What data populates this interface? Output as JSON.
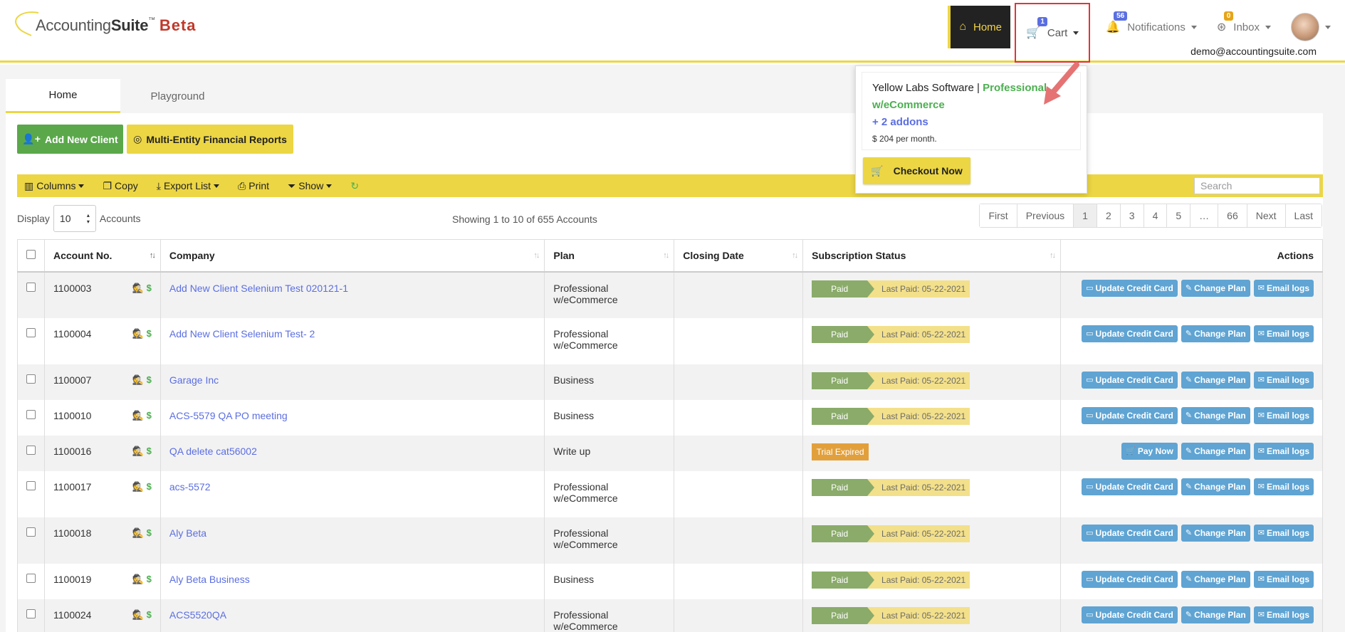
{
  "app": {
    "logo_main": "Accounting",
    "logo_bold": "Suite",
    "logo_tm": "™",
    "logo_beta": "Beta"
  },
  "nav": {
    "home": "Home",
    "cart": "Cart",
    "cart_count": "1",
    "notifications": "Notifications",
    "notifications_count": "56",
    "inbox": "Inbox",
    "inbox_count": "0",
    "user_email": "demo@accountingsuite.com"
  },
  "cart_popover": {
    "company": "Yellow Labs Software",
    "separator": "|",
    "plan": "Professional w/eCommerce",
    "addons": "+ 2 addons",
    "price": "$ 204 per month.",
    "checkout": "Checkout Now"
  },
  "tabs": [
    {
      "label": "Home",
      "active": true
    },
    {
      "label": "Playground",
      "active": false
    }
  ],
  "buttons": {
    "add_client": "Add New Client",
    "multi_entity": "Multi-Entity Financial Reports"
  },
  "toolbar": {
    "columns": "Columns",
    "copy": "Copy",
    "export": "Export List",
    "print": "Print",
    "show": "Show",
    "search_placeholder": "Search"
  },
  "listing": {
    "display_label": "Display",
    "display_value": "10",
    "accounts_label": "Accounts",
    "showing": "Showing 1 to 10 of 655 Accounts"
  },
  "pagination": [
    "First",
    "Previous",
    "1",
    "2",
    "3",
    "4",
    "5",
    "…",
    "66",
    "Next",
    "Last"
  ],
  "table": {
    "headers": {
      "account": "Account No.",
      "company": "Company",
      "plan": "Plan",
      "closing": "Closing Date",
      "status": "Subscription Status",
      "actions": "Actions"
    },
    "rows": [
      {
        "account": "1100003",
        "company": "Add New Client Selenium Test 020121-1",
        "plan1": "Professional",
        "plan2": "w/eCommerce",
        "status": "Paid",
        "last_paid": "Last Paid: 05-22-2021",
        "first_action": "Update Credit Card"
      },
      {
        "account": "1100004",
        "company": "Add New Client Selenium Test- 2",
        "plan1": "Professional",
        "plan2": "w/eCommerce",
        "status": "Paid",
        "last_paid": "Last Paid: 05-22-2021",
        "first_action": "Update Credit Card"
      },
      {
        "account": "1100007",
        "company": "Garage Inc",
        "plan1": "Business",
        "plan2": "",
        "status": "Paid",
        "last_paid": "Last Paid: 05-22-2021",
        "first_action": "Update Credit Card"
      },
      {
        "account": "1100010",
        "company": "ACS-5579 QA PO meeting",
        "plan1": "Business",
        "plan2": "",
        "status": "Paid",
        "last_paid": "Last Paid: 05-22-2021",
        "first_action": "Update Credit Card"
      },
      {
        "account": "1100016",
        "company": "QA delete cat56002",
        "plan1": "Write up",
        "plan2": "",
        "status": "Trial Expired",
        "last_paid": "",
        "first_action": "Pay Now"
      },
      {
        "account": "1100017",
        "company": "acs-5572",
        "plan1": "Professional",
        "plan2": "w/eCommerce",
        "status": "Paid",
        "last_paid": "Last Paid: 05-22-2021",
        "first_action": "Update Credit Card"
      },
      {
        "account": "1100018",
        "company": "Aly Beta",
        "plan1": "Professional",
        "plan2": "w/eCommerce",
        "status": "Paid",
        "last_paid": "Last Paid: 05-22-2021",
        "first_action": "Update Credit Card"
      },
      {
        "account": "1100019",
        "company": "Aly Beta Business",
        "plan1": "Business",
        "plan2": "",
        "status": "Paid",
        "last_paid": "Last Paid: 05-22-2021",
        "first_action": "Update Credit Card"
      },
      {
        "account": "1100024",
        "company": "ACS5520QA",
        "plan1": "Professional",
        "plan2": "w/eCommerce",
        "status": "Paid",
        "last_paid": "Last Paid: 05-22-2021",
        "first_action": "Update Credit Card"
      }
    ],
    "action_change_plan": "Change Plan",
    "action_email_logs": "Email logs"
  },
  "colors": {
    "brand_yellow": "#ecd644",
    "green": "#5aa84a",
    "link_blue": "#5b6ee1",
    "action_blue": "#5fa4d3",
    "alert_red": "#e0343b"
  }
}
